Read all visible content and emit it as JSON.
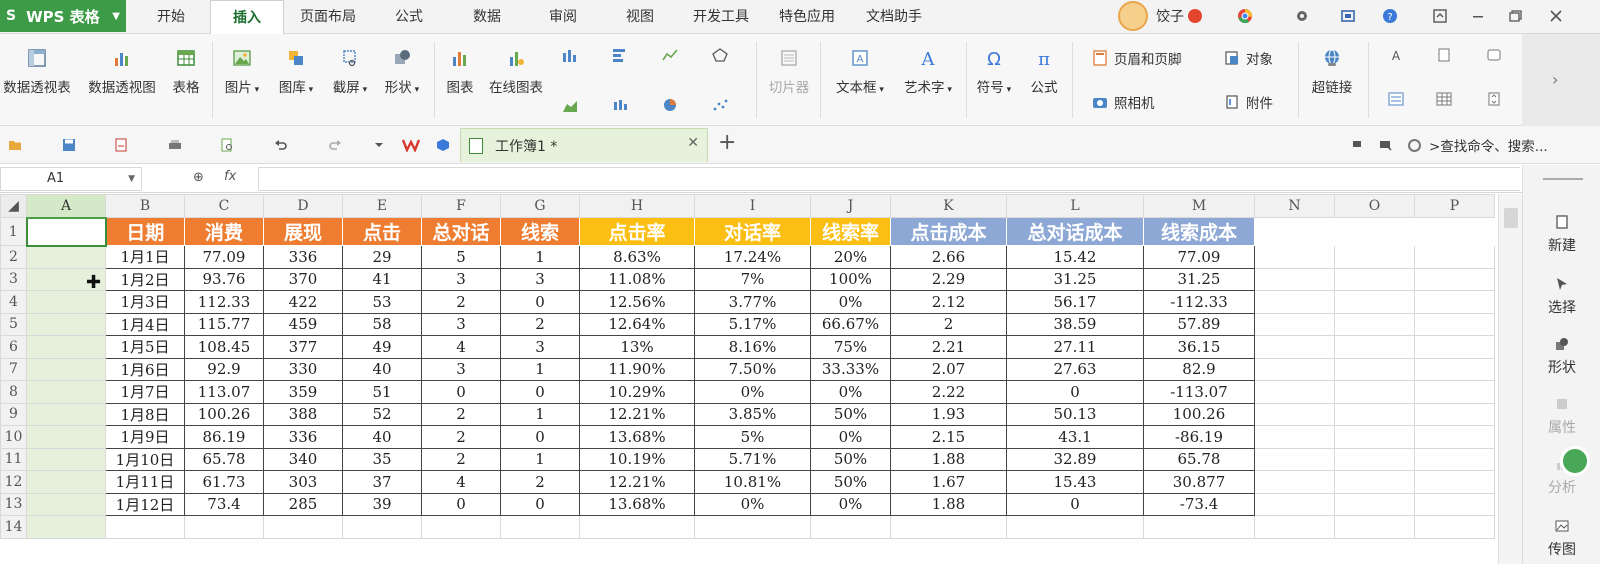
{
  "app": {
    "name": "WPS 表格",
    "logo": "S"
  },
  "menu_tabs": [
    {
      "label": "开始"
    },
    {
      "label": "插入"
    },
    {
      "label": "页面布局"
    },
    {
      "label": "公式"
    },
    {
      "label": "数据"
    },
    {
      "label": "审阅"
    },
    {
      "label": "视图"
    },
    {
      "label": "开发工具"
    },
    {
      "label": "特色应用"
    },
    {
      "label": "文档助手"
    }
  ],
  "active_tab": "插入",
  "user": {
    "name": "饺子"
  },
  "ribbon": {
    "pivot_table": "数据透视表",
    "pivot_chart": "数据透视图",
    "table": "表格",
    "picture": "图片",
    "gallery": "图库",
    "screenshot": "截屏",
    "shape": "形状",
    "chart": "图表",
    "online_chart": "在线图表",
    "slicer": "切片器",
    "textbox": "文本框",
    "wordart": "艺术字",
    "symbol": "符号",
    "formula": "公式",
    "header_footer": "页眉和页脚",
    "camera": "照相机",
    "object": "对象",
    "attachment": "附件",
    "hyperlink": "超链接"
  },
  "doc_tab": {
    "title": "工作簿1 *"
  },
  "command_search": {
    "placeholder": ">查找命令、搜索..."
  },
  "formula_bar": {
    "cell_ref": "A1",
    "fx": "fx",
    "value": ""
  },
  "sheet": {
    "columns": [
      "A",
      "B",
      "C",
      "D",
      "E",
      "F",
      "G",
      "H",
      "I",
      "J",
      "K",
      "L",
      "M",
      "N",
      "O",
      "P"
    ],
    "selected_column": "A",
    "active_cell": "A1",
    "row_numbers": [
      "1",
      "2",
      "3",
      "4",
      "5",
      "6",
      "7",
      "8",
      "9",
      "10",
      "11",
      "12",
      "13",
      "14"
    ],
    "headers": [
      "日期",
      "消费",
      "展现",
      "点击",
      "总对话",
      "线索",
      "点击率",
      "对话率",
      "线索率",
      "点击成本",
      "总对话成本",
      "线索成本"
    ],
    "header_colors": {
      "orange": "#ef7d31",
      "gold": "#fbbe12",
      "blue": "#8ea8d6"
    },
    "rows": [
      [
        "1月1日",
        "77.09",
        "336",
        "29",
        "5",
        "1",
        "8.63%",
        "17.24%",
        "20%",
        "2.66",
        "15.42",
        "77.09"
      ],
      [
        "1月2日",
        "93.76",
        "370",
        "41",
        "3",
        "3",
        "11.08%",
        "7%",
        "100%",
        "2.29",
        "31.25",
        "31.25"
      ],
      [
        "1月3日",
        "112.33",
        "422",
        "53",
        "2",
        "0",
        "12.56%",
        "3.77%",
        "0%",
        "2.12",
        "56.17",
        "-112.33"
      ],
      [
        "1月4日",
        "115.77",
        "459",
        "58",
        "3",
        "2",
        "12.64%",
        "5.17%",
        "66.67%",
        "2",
        "38.59",
        "57.89"
      ],
      [
        "1月5日",
        "108.45",
        "377",
        "49",
        "4",
        "3",
        "13%",
        "8.16%",
        "75%",
        "2.21",
        "27.11",
        "36.15"
      ],
      [
        "1月6日",
        "92.9",
        "330",
        "40",
        "3",
        "1",
        "11.90%",
        "7.50%",
        "33.33%",
        "2.07",
        "27.63",
        "82.9"
      ],
      [
        "1月7日",
        "113.07",
        "359",
        "51",
        "0",
        "0",
        "10.29%",
        "0%",
        "0%",
        "2.22",
        "0",
        "-113.07"
      ],
      [
        "1月8日",
        "100.26",
        "388",
        "52",
        "2",
        "1",
        "12.21%",
        "3.85%",
        "50%",
        "1.93",
        "50.13",
        "100.26"
      ],
      [
        "1月9日",
        "86.19",
        "336",
        "40",
        "2",
        "0",
        "13.68%",
        "5%",
        "0%",
        "2.15",
        "43.1",
        "-86.19"
      ],
      [
        "1月10日",
        "65.78",
        "340",
        "35",
        "2",
        "1",
        "10.19%",
        "5.71%",
        "50%",
        "1.88",
        "32.89",
        "65.78"
      ],
      [
        "1月11日",
        "61.73",
        "303",
        "37",
        "4",
        "2",
        "12.21%",
        "10.81%",
        "50%",
        "1.67",
        "15.43",
        "30.877"
      ],
      [
        "1月12日",
        "73.4",
        "285",
        "39",
        "0",
        "0",
        "13.68%",
        "0%",
        "0%",
        "1.88",
        "0",
        "-73.4"
      ]
    ]
  },
  "task_pane": [
    {
      "label": "新建",
      "icon": "new-icon"
    },
    {
      "label": "选择",
      "icon": "select-icon"
    },
    {
      "label": "形状",
      "icon": "shape-icon"
    },
    {
      "label": "属性",
      "icon": "properties-icon"
    },
    {
      "label": "分析",
      "icon": "analysis-icon"
    },
    {
      "label": "传图",
      "icon": "upload-image-icon"
    }
  ]
}
